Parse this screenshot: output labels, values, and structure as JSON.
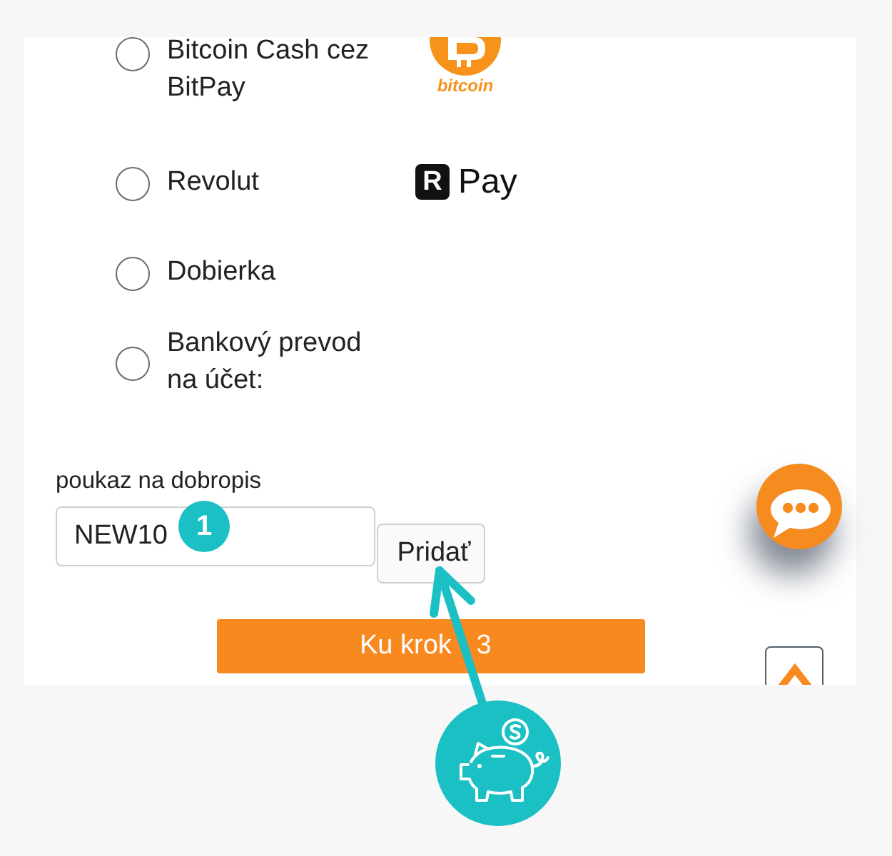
{
  "payment_methods": [
    {
      "kind": "bitcoin",
      "label": "Bitcoin Cash cez BitPay",
      "logo_text": "bitcoin",
      "selected": false
    },
    {
      "kind": "revolut",
      "label": "Revolut",
      "logo_mark": "R",
      "logo_text": "Pay",
      "selected": false
    },
    {
      "kind": "plain",
      "label": "Dobierka",
      "selected": false
    },
    {
      "kind": "plain",
      "label": "Bankový prevod na účet:",
      "selected": false
    }
  ],
  "voucher": {
    "label": "poukaz na dobropis",
    "value": "NEW10",
    "button": "Pridať"
  },
  "annotation": {
    "badge": "1"
  },
  "next_button": {
    "label_parts": [
      "Ku krok",
      "3"
    ]
  }
}
